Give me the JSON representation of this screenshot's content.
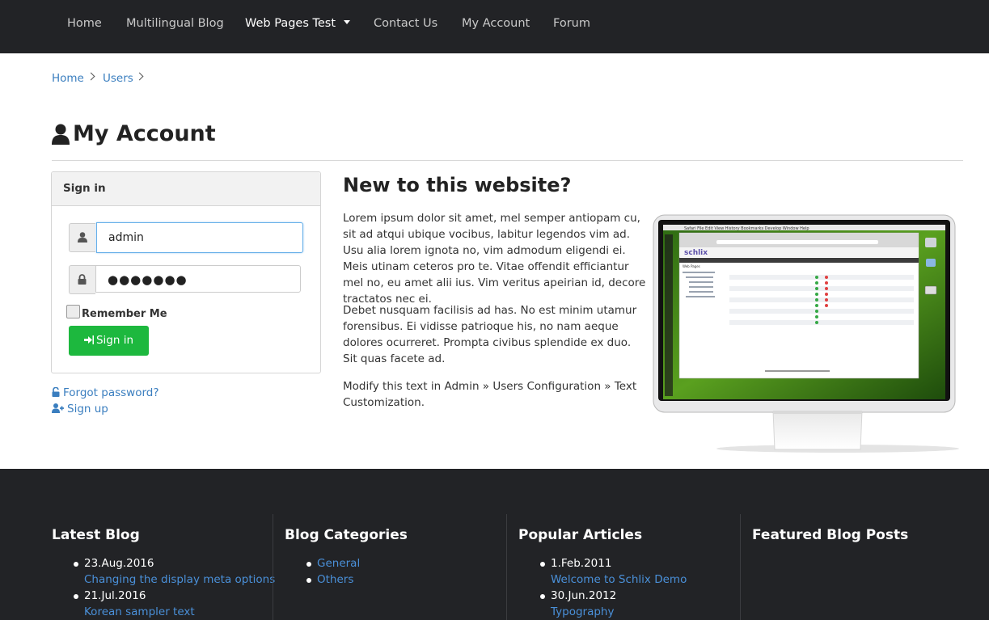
{
  "nav": {
    "items": [
      {
        "label": "Home"
      },
      {
        "label": "Multilingual Blog"
      },
      {
        "label": "Web Pages Test"
      },
      {
        "label": "Contact Us"
      },
      {
        "label": "My Account"
      },
      {
        "label": "Forum"
      }
    ]
  },
  "breadcrumb": [
    "Home",
    "Users"
  ],
  "page": {
    "title": "My Account"
  },
  "signin": {
    "heading": "Sign in",
    "username_value": "admin",
    "password_value": "●●●●●●●",
    "remember_label": "Remember Me",
    "button_label": "Sign in",
    "forgot_label": "Forgot password?",
    "signup_label": "Sign up"
  },
  "intro": {
    "title": "New to this website?",
    "paragraphs": [
      "Lorem ipsum dolor sit amet, mel semper antiopam cu, sit ad atqui ubique vocibus, labitur legendos vim ad. Usu alia lorem ignota no, vim admodum eligendi ei. Meis utinam ceteros pro te. Vitae offendit efficiantur mel no, eu amet alii ius. Vim veritus apeirian id, decore tractatos nec ei.",
      "Debet nusquam facilisis ad has. No est minim utamur forensibus. Ei vidisse patrioque his, no nam aeque dolores ocurreret. Prompta civibus splendide ex duo. Sit quas facete ad.",
      "Modify this text in Admin » Users Configuration » Text Customization."
    ]
  },
  "screen_text": {
    "logo": "schlix",
    "menu": "Safari  File  Edit  View  History  Bookmarks  Develop  Window  Help",
    "tab": "Web Pages"
  },
  "footer": {
    "latest_blog": {
      "title": "Latest Blog",
      "items": [
        {
          "date": "23.Aug.2016",
          "link": "Changing the display meta options"
        },
        {
          "date": "21.Jul.2016",
          "link": "Korean sampler text"
        }
      ]
    },
    "blog_categories": {
      "title": "Blog Categories",
      "items": [
        "General",
        "Others"
      ]
    },
    "popular_articles": {
      "title": "Popular Articles",
      "items": [
        {
          "date": "1.Feb.2011",
          "link": "Welcome to Schlix Demo"
        },
        {
          "date": "30.Jun.2012",
          "link": "Typography"
        }
      ]
    },
    "featured": {
      "title": "Featured Blog Posts"
    }
  },
  "colors": {
    "nav_bg": "#222326",
    "link": "#3a7ebf",
    "button_green": "#1db83e",
    "footer_link": "#4a90d9"
  }
}
